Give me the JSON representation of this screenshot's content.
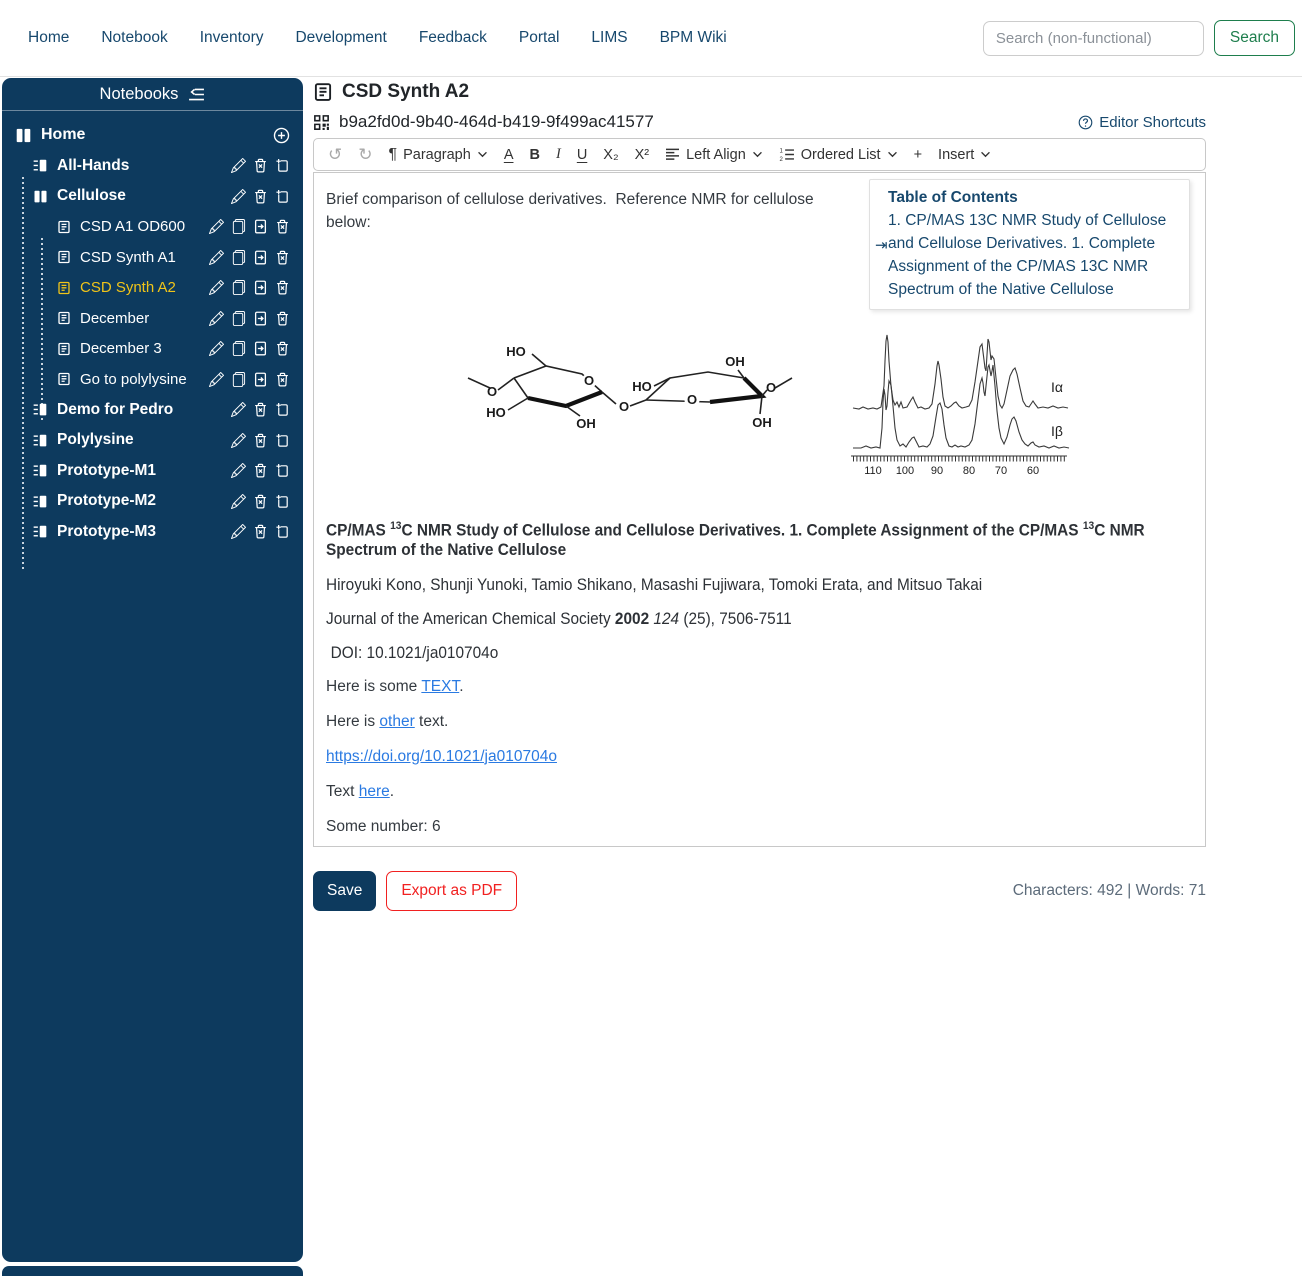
{
  "nav": {
    "items": [
      "Home",
      "Notebook",
      "Inventory",
      "Development",
      "Feedback",
      "Portal",
      "LIMS",
      "BPM Wiki"
    ],
    "search_placeholder": "Search (non-functional)",
    "search_button": "Search"
  },
  "sidebar": {
    "title": "Notebooks",
    "home_label": "Home",
    "notebooks": [
      "All-Hands",
      "Cellulose",
      "Demo for Pedro",
      "Polylysine",
      "Prototype-M1",
      "Prototype-M2",
      "Prototype-M3"
    ],
    "entries": [
      "CSD A1 OD600",
      "CSD Synth A1",
      "CSD Synth A2",
      "December",
      "December 3",
      "Go to polylysine"
    ],
    "selected_entry": "CSD Synth A2"
  },
  "page": {
    "title": "CSD Synth A2",
    "uuid": "b9a2fd0d-9b40-464d-b419-9f499ac41577",
    "editor_shortcuts": "Editor Shortcuts"
  },
  "toolbar": {
    "paragraph": "Paragraph",
    "font_color": "A",
    "bold": "B",
    "italic": "I",
    "underline": "U",
    "subscript": "X₂",
    "superscript": "X²",
    "align": "Left Align",
    "list": "Ordered List",
    "insert": "Insert"
  },
  "icons": {
    "undo": "↺",
    "redo": "↻",
    "pilcrow": "¶",
    "plus": "+",
    "toc_jump": "⇥"
  },
  "toc": {
    "title": "Table of Contents",
    "entry": "1. CP/MAS 13C NMR Study of Cellulose and Cellulose Derivatives. 1. Complete Assignment of the CP/MAS 13C NMR Spectrum of the Native Cellulose"
  },
  "doc": {
    "intro": "Brief comparison of cellulose derivatives.  Reference NMR for cellulose below:",
    "citation": {
      "t1": "CP/MAS ",
      "t1s": "13",
      "t2": "C NMR Study of Cellulose and Cellulose Derivatives. 1. Complete Assignment of the CP/MAS ",
      "t2s": "13",
      "t3": "C NMR Spectrum of the Native Cellulose",
      "authors": "Hiroyuki Kono, Shunji Yunoki, Tamio Shikano, Masashi Fujiwara, Tomoki Erata, and Mitsuo Takai",
      "journal": "Journal of the American Chemical Society ",
      "year": "2002",
      "volume": " 124",
      "pages": " (25), 7506-7511",
      "doi": "DOI: 10.1021/ja010704o"
    },
    "p1": {
      "pre": "Here is some ",
      "link": "TEXT",
      "post": "."
    },
    "p2": {
      "pre": "Here is ",
      "link": "other",
      "post": " text."
    },
    "p3": {
      "link": "https://doi.org/10.1021/ja010704o"
    },
    "p4": {
      "pre": "Text ",
      "link": "here",
      "post": "."
    },
    "p5": "Some number: 6"
  },
  "figures": {
    "nmr": {
      "ticks": [
        "110",
        "100",
        "90",
        "80",
        "70",
        "60"
      ],
      "label_alpha": "Iα",
      "label_beta": "Iβ"
    },
    "structure": {
      "labels": [
        "HO",
        "O",
        "HO",
        "OH",
        "O",
        "O",
        "HO",
        "OH",
        "O",
        "O",
        "OH"
      ]
    }
  },
  "footer": {
    "save": "Save",
    "export": "Export as PDF",
    "stats": "Characters: 492 | Words: 71"
  },
  "colors": {
    "sidebar_navy": "#0d3a5e",
    "nav_link": "#17486d",
    "selected_yellow": "#f0c419",
    "link_blue": "#2a7ae2",
    "danger_red": "#f12020",
    "search_green": "#1e7e4d"
  }
}
